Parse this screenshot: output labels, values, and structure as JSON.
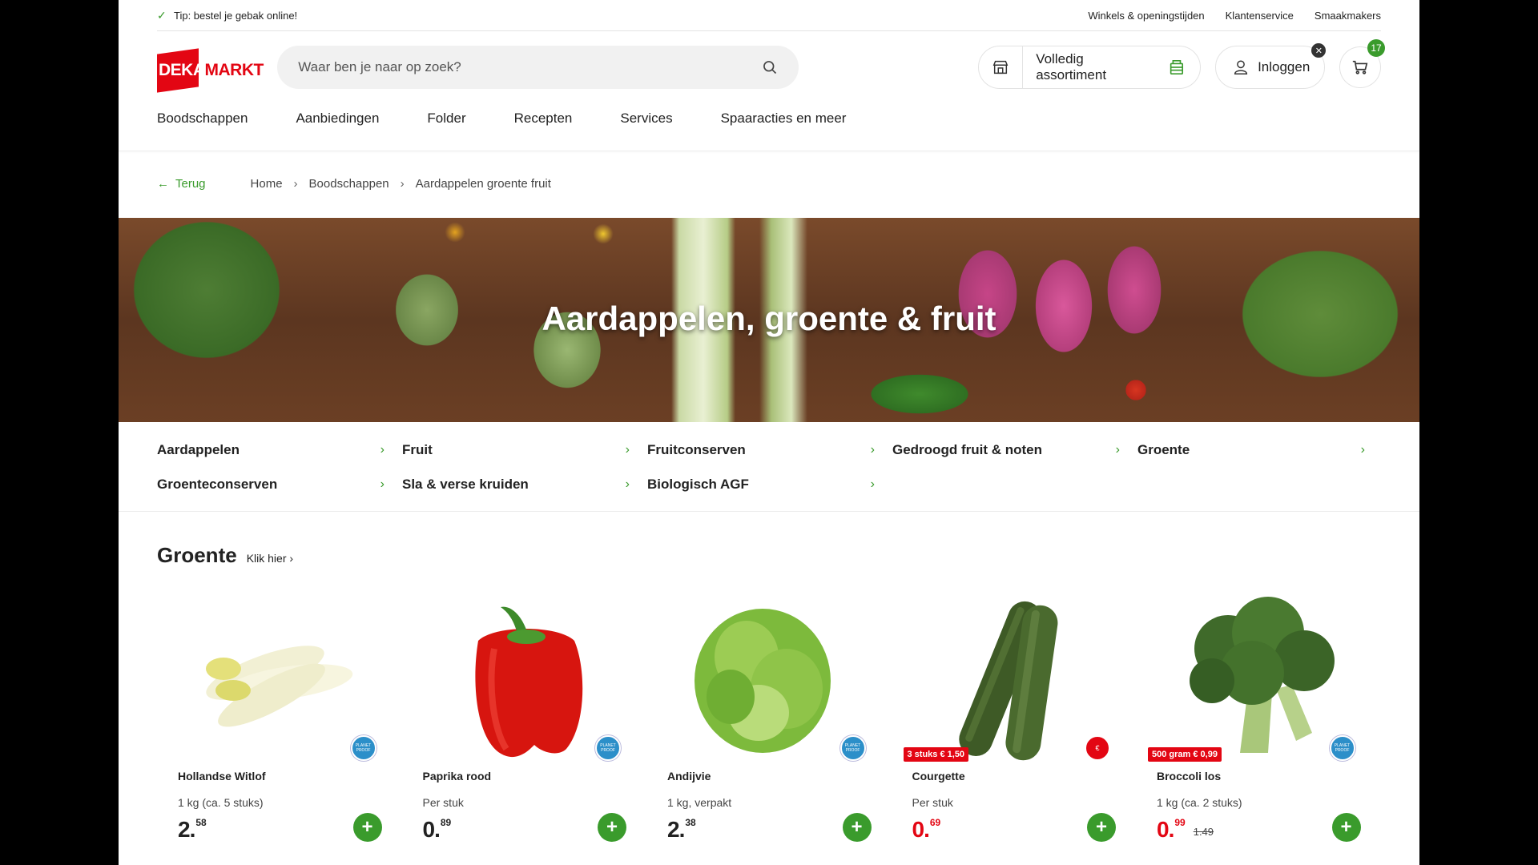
{
  "topbar": {
    "tip": "Tip: bestel je gebak online!",
    "links": [
      "Winkels & openingstijden",
      "Klantenservice",
      "Smaakmakers"
    ]
  },
  "header": {
    "logo_text_a": "DEKA",
    "logo_text_b": "MARKT",
    "search_placeholder": "Waar ben je naar op zoek?",
    "assortment_label": "Volledig assortiment",
    "login_label": "Inloggen",
    "cart_count": "17"
  },
  "nav": [
    "Boodschappen",
    "Aanbiedingen",
    "Folder",
    "Recepten",
    "Services",
    "Spaaracties en meer"
  ],
  "breadcrumb": {
    "back": "Terug",
    "items": [
      "Home",
      "Boodschappen",
      "Aardappelen groente fruit"
    ]
  },
  "hero": {
    "title": "Aardappelen, groente & fruit"
  },
  "categories": [
    "Aardappelen",
    "Fruit",
    "Fruitconserven",
    "Gedroogd fruit & noten",
    "Groente",
    "Groenteconserven",
    "Sla & verse kruiden",
    "Biologisch AGF"
  ],
  "section": {
    "title": "Groente",
    "more": "Klik hier"
  },
  "products": [
    {
      "name": "Hollandse Witlof",
      "unit": "1 kg (ca. 5 stuks)",
      "price_int": "2.",
      "price_dec": "58",
      "tag": "",
      "old": "",
      "badge": "PLANET PROOF"
    },
    {
      "name": "Paprika rood",
      "unit": "Per stuk",
      "price_int": "0.",
      "price_dec": "89",
      "tag": "",
      "old": "",
      "badge": "PLANET PROOF"
    },
    {
      "name": "Andijvie",
      "unit": "1 kg, verpakt",
      "price_int": "2.",
      "price_dec": "38",
      "tag": "",
      "old": "",
      "badge": "PLANET PROOF"
    },
    {
      "name": "Courgette",
      "unit": "Per stuk",
      "price_int": "0.",
      "price_dec": "69",
      "tag": "3 stuks € 1,50",
      "old": "",
      "badge": "€"
    },
    {
      "name": "Broccoli los",
      "unit": "1 kg (ca. 2 stuks)",
      "price_int": "0.",
      "price_dec": "99",
      "tag": "500 gram € 0,99",
      "old": "1.49",
      "badge": "PLANET PROOF"
    }
  ],
  "colors": {
    "brand_red": "#e30613",
    "accent_green": "#3a9b2c"
  }
}
